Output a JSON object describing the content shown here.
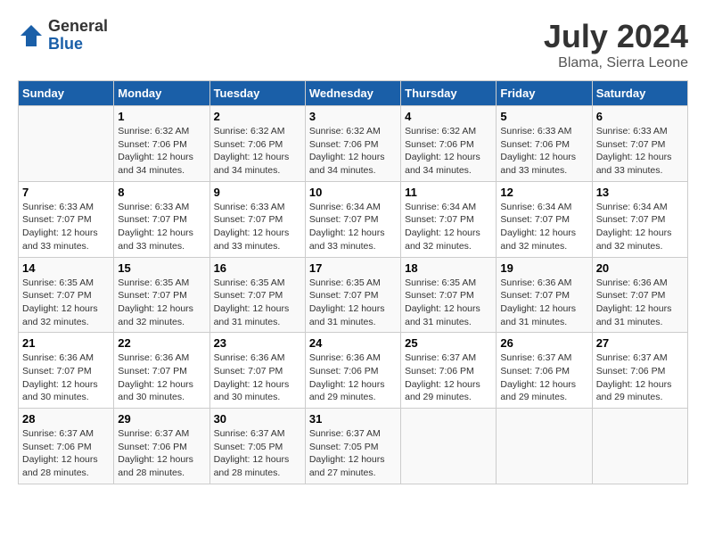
{
  "header": {
    "logo_general": "General",
    "logo_blue": "Blue",
    "month_year": "July 2024",
    "location": "Blama, Sierra Leone"
  },
  "days_of_week": [
    "Sunday",
    "Monday",
    "Tuesday",
    "Wednesday",
    "Thursday",
    "Friday",
    "Saturday"
  ],
  "weeks": [
    [
      {
        "day": "",
        "sunrise": "",
        "sunset": "",
        "daylight": ""
      },
      {
        "day": "1",
        "sunrise": "Sunrise: 6:32 AM",
        "sunset": "Sunset: 7:06 PM",
        "daylight": "Daylight: 12 hours and 34 minutes."
      },
      {
        "day": "2",
        "sunrise": "Sunrise: 6:32 AM",
        "sunset": "Sunset: 7:06 PM",
        "daylight": "Daylight: 12 hours and 34 minutes."
      },
      {
        "day": "3",
        "sunrise": "Sunrise: 6:32 AM",
        "sunset": "Sunset: 7:06 PM",
        "daylight": "Daylight: 12 hours and 34 minutes."
      },
      {
        "day": "4",
        "sunrise": "Sunrise: 6:32 AM",
        "sunset": "Sunset: 7:06 PM",
        "daylight": "Daylight: 12 hours and 34 minutes."
      },
      {
        "day": "5",
        "sunrise": "Sunrise: 6:33 AM",
        "sunset": "Sunset: 7:06 PM",
        "daylight": "Daylight: 12 hours and 33 minutes."
      },
      {
        "day": "6",
        "sunrise": "Sunrise: 6:33 AM",
        "sunset": "Sunset: 7:07 PM",
        "daylight": "Daylight: 12 hours and 33 minutes."
      }
    ],
    [
      {
        "day": "7",
        "sunrise": "Sunrise: 6:33 AM",
        "sunset": "Sunset: 7:07 PM",
        "daylight": "Daylight: 12 hours and 33 minutes."
      },
      {
        "day": "8",
        "sunrise": "Sunrise: 6:33 AM",
        "sunset": "Sunset: 7:07 PM",
        "daylight": "Daylight: 12 hours and 33 minutes."
      },
      {
        "day": "9",
        "sunrise": "Sunrise: 6:33 AM",
        "sunset": "Sunset: 7:07 PM",
        "daylight": "Daylight: 12 hours and 33 minutes."
      },
      {
        "day": "10",
        "sunrise": "Sunrise: 6:34 AM",
        "sunset": "Sunset: 7:07 PM",
        "daylight": "Daylight: 12 hours and 33 minutes."
      },
      {
        "day": "11",
        "sunrise": "Sunrise: 6:34 AM",
        "sunset": "Sunset: 7:07 PM",
        "daylight": "Daylight: 12 hours and 32 minutes."
      },
      {
        "day": "12",
        "sunrise": "Sunrise: 6:34 AM",
        "sunset": "Sunset: 7:07 PM",
        "daylight": "Daylight: 12 hours and 32 minutes."
      },
      {
        "day": "13",
        "sunrise": "Sunrise: 6:34 AM",
        "sunset": "Sunset: 7:07 PM",
        "daylight": "Daylight: 12 hours and 32 minutes."
      }
    ],
    [
      {
        "day": "14",
        "sunrise": "Sunrise: 6:35 AM",
        "sunset": "Sunset: 7:07 PM",
        "daylight": "Daylight: 12 hours and 32 minutes."
      },
      {
        "day": "15",
        "sunrise": "Sunrise: 6:35 AM",
        "sunset": "Sunset: 7:07 PM",
        "daylight": "Daylight: 12 hours and 32 minutes."
      },
      {
        "day": "16",
        "sunrise": "Sunrise: 6:35 AM",
        "sunset": "Sunset: 7:07 PM",
        "daylight": "Daylight: 12 hours and 31 minutes."
      },
      {
        "day": "17",
        "sunrise": "Sunrise: 6:35 AM",
        "sunset": "Sunset: 7:07 PM",
        "daylight": "Daylight: 12 hours and 31 minutes."
      },
      {
        "day": "18",
        "sunrise": "Sunrise: 6:35 AM",
        "sunset": "Sunset: 7:07 PM",
        "daylight": "Daylight: 12 hours and 31 minutes."
      },
      {
        "day": "19",
        "sunrise": "Sunrise: 6:36 AM",
        "sunset": "Sunset: 7:07 PM",
        "daylight": "Daylight: 12 hours and 31 minutes."
      },
      {
        "day": "20",
        "sunrise": "Sunrise: 6:36 AM",
        "sunset": "Sunset: 7:07 PM",
        "daylight": "Daylight: 12 hours and 31 minutes."
      }
    ],
    [
      {
        "day": "21",
        "sunrise": "Sunrise: 6:36 AM",
        "sunset": "Sunset: 7:07 PM",
        "daylight": "Daylight: 12 hours and 30 minutes."
      },
      {
        "day": "22",
        "sunrise": "Sunrise: 6:36 AM",
        "sunset": "Sunset: 7:07 PM",
        "daylight": "Daylight: 12 hours and 30 minutes."
      },
      {
        "day": "23",
        "sunrise": "Sunrise: 6:36 AM",
        "sunset": "Sunset: 7:07 PM",
        "daylight": "Daylight: 12 hours and 30 minutes."
      },
      {
        "day": "24",
        "sunrise": "Sunrise: 6:36 AM",
        "sunset": "Sunset: 7:06 PM",
        "daylight": "Daylight: 12 hours and 29 minutes."
      },
      {
        "day": "25",
        "sunrise": "Sunrise: 6:37 AM",
        "sunset": "Sunset: 7:06 PM",
        "daylight": "Daylight: 12 hours and 29 minutes."
      },
      {
        "day": "26",
        "sunrise": "Sunrise: 6:37 AM",
        "sunset": "Sunset: 7:06 PM",
        "daylight": "Daylight: 12 hours and 29 minutes."
      },
      {
        "day": "27",
        "sunrise": "Sunrise: 6:37 AM",
        "sunset": "Sunset: 7:06 PM",
        "daylight": "Daylight: 12 hours and 29 minutes."
      }
    ],
    [
      {
        "day": "28",
        "sunrise": "Sunrise: 6:37 AM",
        "sunset": "Sunset: 7:06 PM",
        "daylight": "Daylight: 12 hours and 28 minutes."
      },
      {
        "day": "29",
        "sunrise": "Sunrise: 6:37 AM",
        "sunset": "Sunset: 7:06 PM",
        "daylight": "Daylight: 12 hours and 28 minutes."
      },
      {
        "day": "30",
        "sunrise": "Sunrise: 6:37 AM",
        "sunset": "Sunset: 7:05 PM",
        "daylight": "Daylight: 12 hours and 28 minutes."
      },
      {
        "day": "31",
        "sunrise": "Sunrise: 6:37 AM",
        "sunset": "Sunset: 7:05 PM",
        "daylight": "Daylight: 12 hours and 27 minutes."
      },
      {
        "day": "",
        "sunrise": "",
        "sunset": "",
        "daylight": ""
      },
      {
        "day": "",
        "sunrise": "",
        "sunset": "",
        "daylight": ""
      },
      {
        "day": "",
        "sunrise": "",
        "sunset": "",
        "daylight": ""
      }
    ]
  ]
}
